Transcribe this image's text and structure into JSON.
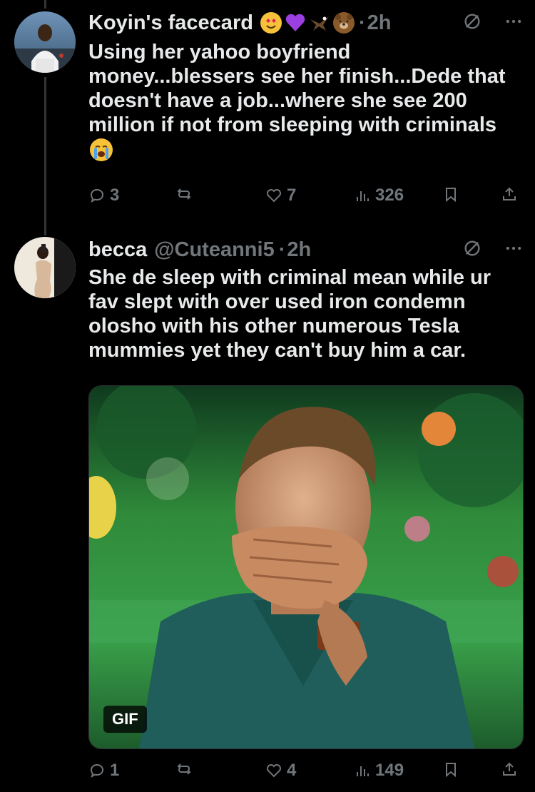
{
  "tweets": [
    {
      "display_name": "Koyin's facecard",
      "handle": "",
      "sep": "·",
      "time": "2h",
      "text": "Using her yahoo boyfriend money...blessers see her finish...Dede that doesn't have a job...where she see 200 million if not from sleeping with criminals",
      "replies": "3",
      "reposts": "",
      "likes": "7",
      "views": "326"
    },
    {
      "display_name": "becca",
      "handle": "@Cuteanni5",
      "sep": "·",
      "time": "2h",
      "text": "She de sleep with criminal mean while ur fav slept with over used iron condemn olosho with his other numerous Tesla mummies yet they can't buy him a car.",
      "media_badge": "GIF",
      "replies": "1",
      "reposts": "",
      "likes": "4",
      "views": "149"
    }
  ],
  "colors": {
    "background": "#000000",
    "text_primary": "#e7e9ea",
    "text_secondary": "#71767b",
    "thread_line": "#333639"
  },
  "icons": [
    "reply-icon",
    "repost-icon",
    "like-icon",
    "views-icon",
    "bookmark-icon",
    "share-icon",
    "grok-icon",
    "more-icon"
  ]
}
